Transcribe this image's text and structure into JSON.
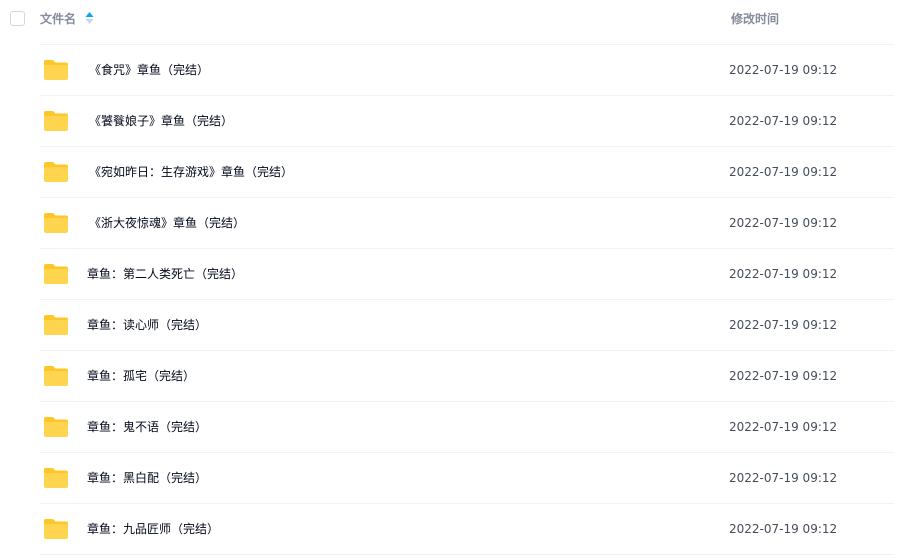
{
  "header": {
    "name_label": "文件名",
    "time_label": "修改时间"
  },
  "colors": {
    "folder_body": "#ffd44f",
    "folder_tab": "#ffc629",
    "sort_active": "#06a7ff",
    "sort_inactive": "#c5d5f2"
  },
  "files": [
    {
      "name": "《食咒》章鱼（完结）",
      "time": "2022-07-19 09:12",
      "icon": "folder-icon"
    },
    {
      "name": "《饕餮娘子》章鱼（完结）",
      "time": "2022-07-19 09:12",
      "icon": "folder-icon"
    },
    {
      "name": "《宛如昨日：生存游戏》章鱼（完结）",
      "time": "2022-07-19 09:12",
      "icon": "folder-icon"
    },
    {
      "name": "《浙大夜惊魂》章鱼（完结）",
      "time": "2022-07-19 09:12",
      "icon": "folder-icon"
    },
    {
      "name": "章鱼：第二人类死亡（完结）",
      "time": "2022-07-19 09:12",
      "icon": "folder-icon"
    },
    {
      "name": "章鱼：读心师（完结）",
      "time": "2022-07-19 09:12",
      "icon": "folder-icon"
    },
    {
      "name": "章鱼：孤宅（完结）",
      "time": "2022-07-19 09:12",
      "icon": "folder-icon"
    },
    {
      "name": "章鱼：鬼不语（完结）",
      "time": "2022-07-19 09:12",
      "icon": "folder-icon"
    },
    {
      "name": "章鱼：黑白配（完结）",
      "time": "2022-07-19 09:12",
      "icon": "folder-icon"
    },
    {
      "name": "章鱼：九品匠师（完结）",
      "time": "2022-07-19 09:12",
      "icon": "folder-icon"
    }
  ]
}
